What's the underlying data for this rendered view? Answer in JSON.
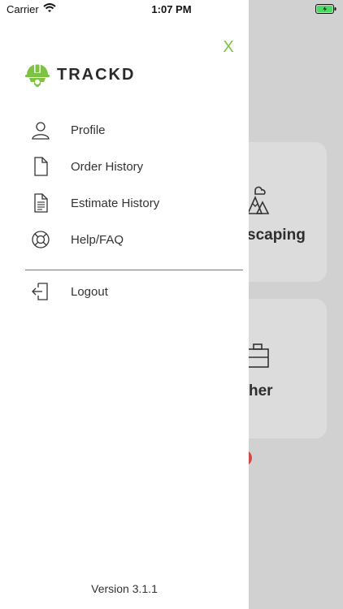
{
  "status_bar": {
    "carrier": "Carrier",
    "time": "1:07 PM",
    "battery_color": "#4cd964"
  },
  "drawer": {
    "close_label": "X",
    "brand_name": "TRACKD",
    "brand_color": "#7dc242",
    "menu": [
      {
        "label": "Profile",
        "icon": "person-icon"
      },
      {
        "label": "Order History",
        "icon": "document-icon"
      },
      {
        "label": "Estimate History",
        "icon": "list-document-icon"
      },
      {
        "label": "Help/FAQ",
        "icon": "lifebuoy-icon"
      }
    ],
    "logout_label": "Logout",
    "version": "Version 3.1.1"
  },
  "background": {
    "cards": [
      {
        "label": "scaping",
        "icon": "landscape-icon"
      },
      {
        "label": "her",
        "icon": "briefcase-icon"
      }
    ]
  }
}
